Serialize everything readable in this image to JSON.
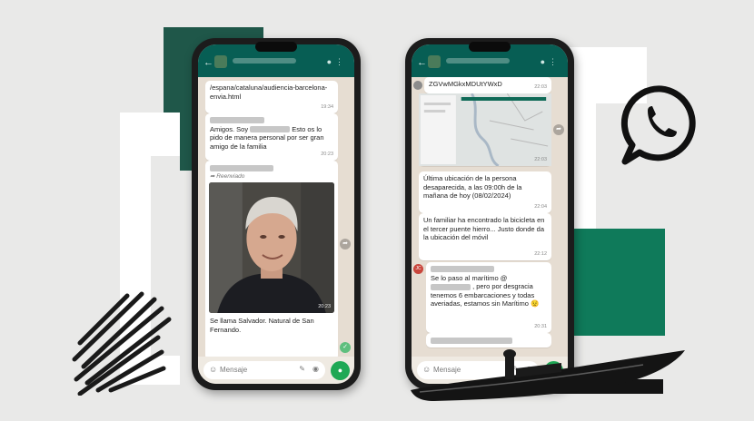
{
  "colors": {
    "background": "#e9e9e8",
    "dark_green": "#1f5749",
    "mid_green": "#0f7a5a",
    "white_frame": "#ffffff",
    "whatsapp_header": "#075e54",
    "chat_bg": "#e6ddd2",
    "mic_green": "#1fa855"
  },
  "icons": [
    "back-arrow-icon",
    "avatar-icon",
    "emoji-icon",
    "attach-icon",
    "camera-icon",
    "mic-icon",
    "forward-icon",
    "whatsapp-logo-icon",
    "scribble-icon",
    "boat-icon"
  ],
  "phone_left": {
    "messages": [
      {
        "text": "/espana/cataluna/audiencia-barcelona-envia.html",
        "time": "19:34"
      },
      {
        "text_before": "Amigos. Soy",
        "text_after": "Esto os lo pido de manera personal por ser gran amigo de la familia",
        "time": "20:23"
      },
      {
        "forwarded_label": "Reenviado",
        "caption": "Se llama Salvador. Natural de San Fernando.",
        "time": "20:23"
      }
    ],
    "input_placeholder": "Mensaje"
  },
  "phone_right": {
    "messages": [
      {
        "text": "ZGVwMGkxMDUtYWxD",
        "time": "22:03"
      },
      {
        "type": "map",
        "time": "22:03"
      },
      {
        "text": "Última ubicación de la persona desaparecida, a las 09:00h de la mañana de hoy (08/02/2024)",
        "time": "22:04"
      },
      {
        "text": "Un familiar ha encontrado la bicicleta en el tercer puente hierro... Justo donde da la ubicación del móvil",
        "time": "22:12"
      },
      {
        "avatar_initials": "JC",
        "text_before": "Se lo paso al marítimo @",
        "text_after": ", pero por desgracia tenemos 6 embarcaciones y todas averiadas, estamos sin Marítimo 😟",
        "time": "20:31"
      }
    ],
    "input_placeholder": "Mensaje"
  }
}
